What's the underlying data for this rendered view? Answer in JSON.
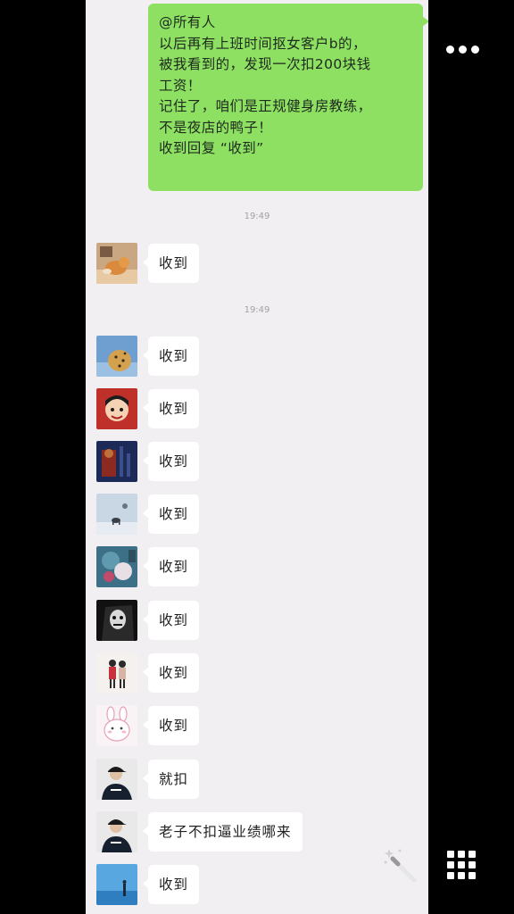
{
  "self_message": {
    "lines": [
      "@所有人",
      "以后再有上班时间抠女客户b的，",
      "被我看到的，发现一次扣200块钱",
      "工资！",
      "记住了，咱们是正规健身房教练，",
      "不是夜店的鸭子！",
      "收到回复 “收到”"
    ],
    "bubble_color": "#8ee062"
  },
  "timestamps": [
    "19:49",
    "19:49"
  ],
  "messages": [
    {
      "avatar": "dog-avatar",
      "text": "收到"
    },
    {
      "avatar": "cheetah-avatar",
      "text": "收到"
    },
    {
      "avatar": "cartoon-boy-avatar",
      "text": "收到"
    },
    {
      "avatar": "dark-poster-avatar",
      "text": "收到"
    },
    {
      "avatar": "elephant-sky-avatar",
      "text": "收到"
    },
    {
      "avatar": "blue-photo-avatar",
      "text": "收到"
    },
    {
      "avatar": "black-white-sketch-avatar",
      "text": "收到"
    },
    {
      "avatar": "couple-avatar",
      "text": "收到"
    },
    {
      "avatar": "bunny-avatar",
      "text": "收到"
    },
    {
      "avatar": "man-cap-avatar",
      "text": "就扣"
    },
    {
      "avatar": "man-cap-avatar",
      "text": "老子不扣逼业绩哪来"
    },
    {
      "avatar": "blue-sea-avatar",
      "text": "收到"
    }
  ],
  "overlay": {
    "more_icon": "more-dots-icon",
    "grid_icon": "grid-icon",
    "wand_icon": "magic-wand-icon"
  },
  "colors": {
    "chat_background": "#f1eff2",
    "incoming_bubble": "#ffffff",
    "timestamp": "#a3a0a6",
    "outer_background": "#000000"
  }
}
